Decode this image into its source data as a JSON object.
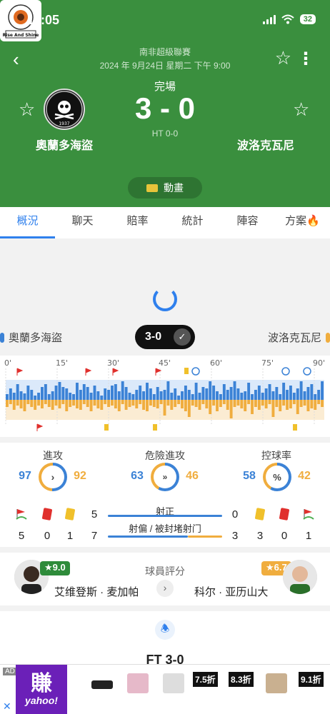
{
  "status": {
    "time": "11:05",
    "battery": "32"
  },
  "header": {
    "league": "南非超級聯賽",
    "date": "2024 年 9月24日 星期二 下午 9:00",
    "match_status": "完場",
    "score": "3 - 0",
    "ht": "HT 0-0",
    "home_team": "奧蘭多海盜",
    "away_team": "波洛克瓦尼",
    "home_logo_year": "1937",
    "away_logo_text": "Rise And Shine",
    "animation_label": "動畫"
  },
  "tabs": [
    "概況",
    "聊天",
    "賠率",
    "統計",
    "陣容",
    "方案"
  ],
  "bar": {
    "home": "奧蘭多海盜",
    "away": "波洛克瓦尼",
    "score": "3-0"
  },
  "timeline": {
    "ticks": [
      "0'",
      "15'",
      "30'",
      "45'",
      "60'",
      "75'",
      "90'"
    ],
    "home_bars": [
      8,
      16,
      10,
      22,
      12,
      9,
      20,
      14,
      6,
      10,
      18,
      22,
      8,
      12,
      20,
      25,
      18,
      16,
      10,
      8,
      24,
      14,
      22,
      18,
      10,
      20,
      12,
      6,
      16,
      14,
      20,
      22,
      12,
      26,
      18,
      10,
      8,
      14,
      20,
      12,
      24,
      16,
      8,
      18,
      12,
      14,
      26,
      10,
      16,
      6,
      12,
      20,
      14,
      8,
      24,
      10,
      18,
      16,
      26,
      20,
      12,
      8,
      22,
      14,
      18,
      26,
      16,
      10,
      12,
      24,
      8,
      14,
      20,
      10,
      16,
      22,
      12,
      18,
      8,
      24,
      14,
      20,
      10,
      16,
      26,
      12,
      18,
      22,
      8,
      14,
      26
    ],
    "away_bars": [
      10,
      6,
      14,
      8,
      12,
      16,
      6,
      10,
      14,
      8,
      12,
      6,
      10,
      14,
      8,
      12,
      6,
      16,
      10,
      8,
      12,
      14,
      6,
      10,
      16,
      8,
      12,
      14,
      6,
      10,
      8,
      12,
      16,
      6,
      14,
      10,
      8,
      12,
      6,
      14,
      16,
      8,
      10,
      12,
      6,
      22,
      8,
      14,
      10,
      6,
      12,
      16,
      24,
      8,
      10,
      14,
      6,
      12,
      20,
      8,
      16,
      10,
      6,
      14,
      26,
      10,
      8,
      12,
      16,
      6,
      20,
      10,
      14,
      8,
      12,
      6,
      24,
      10,
      16,
      8,
      14,
      12,
      6,
      20,
      10,
      8,
      16,
      12,
      14,
      6,
      10
    ]
  },
  "stats": {
    "attack": {
      "label": "進攻",
      "home": "97",
      "away": "92"
    },
    "danger": {
      "label": "危險進攻",
      "home": "63",
      "away": "46"
    },
    "possession": {
      "label": "控球率",
      "home": "58",
      "away": "42"
    },
    "on_target_label": "射正",
    "off_target_label": "射偏 / 被封堵射门",
    "home_on_target": "5",
    "away_on_target": "0",
    "home_corners": "5",
    "home_red": "0",
    "home_yellow": "1",
    "home_off": "7",
    "away_off": "3",
    "away_yellow": "3",
    "away_red": "0",
    "away_corners": "1"
  },
  "ratings": {
    "title": "球員評分",
    "home_player": "艾维登斯 · 麦加帕",
    "home_rating": "★9.0",
    "away_player": "科尔 · 亚历山大",
    "away_rating": "★6.7"
  },
  "events": {
    "ft": "FT 3-0"
  },
  "ad": {
    "tag": "AD",
    "logo_big": "賺",
    "logo_small": "yahoo!",
    "discounts": [
      "7.5折",
      "8.3折",
      "9.1折"
    ]
  },
  "colors": {
    "header_green": "#3a8f3e",
    "home_blue": "#3b82d6",
    "away_orange": "#f0ad3e",
    "accent": "#2f80ed"
  }
}
